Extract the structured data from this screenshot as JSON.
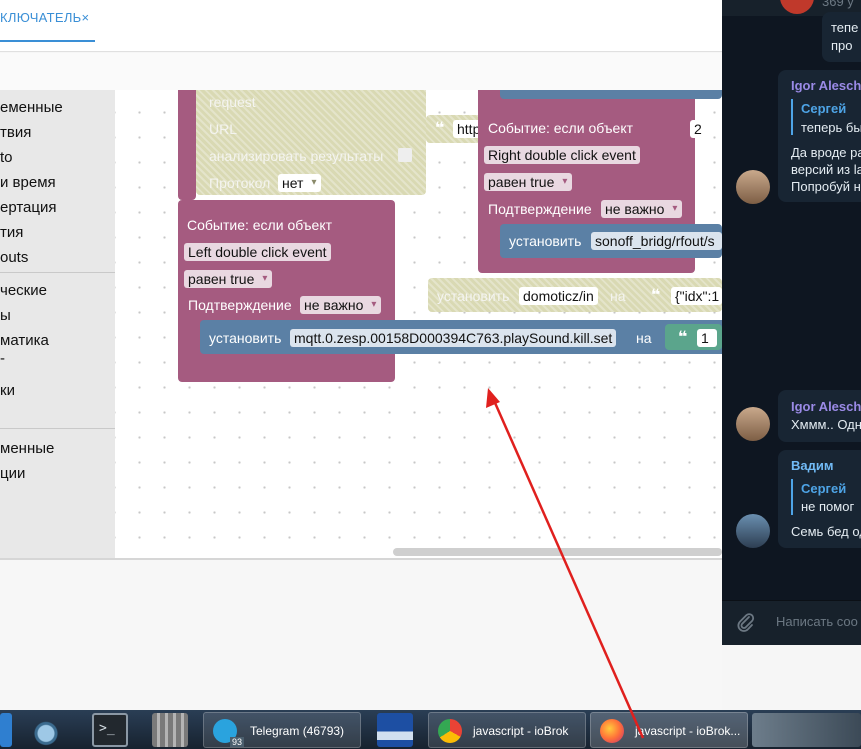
{
  "topbar": {
    "tab_label": "КЛЮЧАТЕЛЬ×"
  },
  "sidebar": {
    "items": [
      "еменные",
      "твия",
      "to",
      "и время",
      "ертация",
      "тия",
      "outs",
      "ческие",
      "ы",
      "матика",
      "-",
      "ки",
      "менные",
      "ции"
    ]
  },
  "blocks": {
    "request": {
      "request_label": "request",
      "url_label": "URL",
      "analyze_label": "анализировать результаты",
      "protocol_label": "Протокол",
      "protocol_value": "нет",
      "url_value": "http",
      "right_quote_value": "2"
    },
    "left_event": {
      "title": "Событие: если объект",
      "event_value": "Left double click event",
      "equals_value": "равен true",
      "confirm_label": "Подтверждение",
      "confirm_value": "не важно",
      "set_label": "установить",
      "set_target": "mqtt.0.zesp.00158D000394C763.playSound.kill.set",
      "on_label": "на",
      "on_value": "1"
    },
    "right_event": {
      "title": "Событие: если объект",
      "event_value": "Right double click event",
      "equals_value": "равен true",
      "confirm_label": "Подтверждение",
      "confirm_value": "не важно",
      "set_label": "установить",
      "set_target": "sonoff_bridg/rfout/s"
    },
    "domoticz": {
      "set_label": "установить",
      "target": "domoticz/in",
      "on_label": "на",
      "value": "{\"idx\":1"
    }
  },
  "chat": {
    "top_partial_1": "тепе",
    "top_partial_2": "про",
    "top_header": "369 у",
    "msg1": {
      "author": "Igor Alesche",
      "quote_author": "Сергей",
      "quote_text": "теперь бы",
      "line1": "Да вроде ра",
      "line2": "версий из la",
      "line3": "Попробуй н"
    },
    "msg2": {
      "author": "Igor Alesche",
      "text": "Хммм.. Одн"
    },
    "msg3": {
      "author": "Вадим",
      "quote_author": "Сергей",
      "quote_text": "не помог",
      "text": "Семь бед од"
    },
    "input_placeholder": "Написать соо"
  },
  "taskbar": {
    "telegram": "Telegram (46793)",
    "telegram_badge": "93",
    "chrome": "javascript - ioBrok",
    "firefox": "javascript - ioBrok..."
  },
  "colors": {
    "event_block": "#a55b80",
    "action_block": "#5b80a5",
    "request_block": "#d9d9b3",
    "arrow": "#e0201e",
    "accent": "#3a8fd6"
  }
}
